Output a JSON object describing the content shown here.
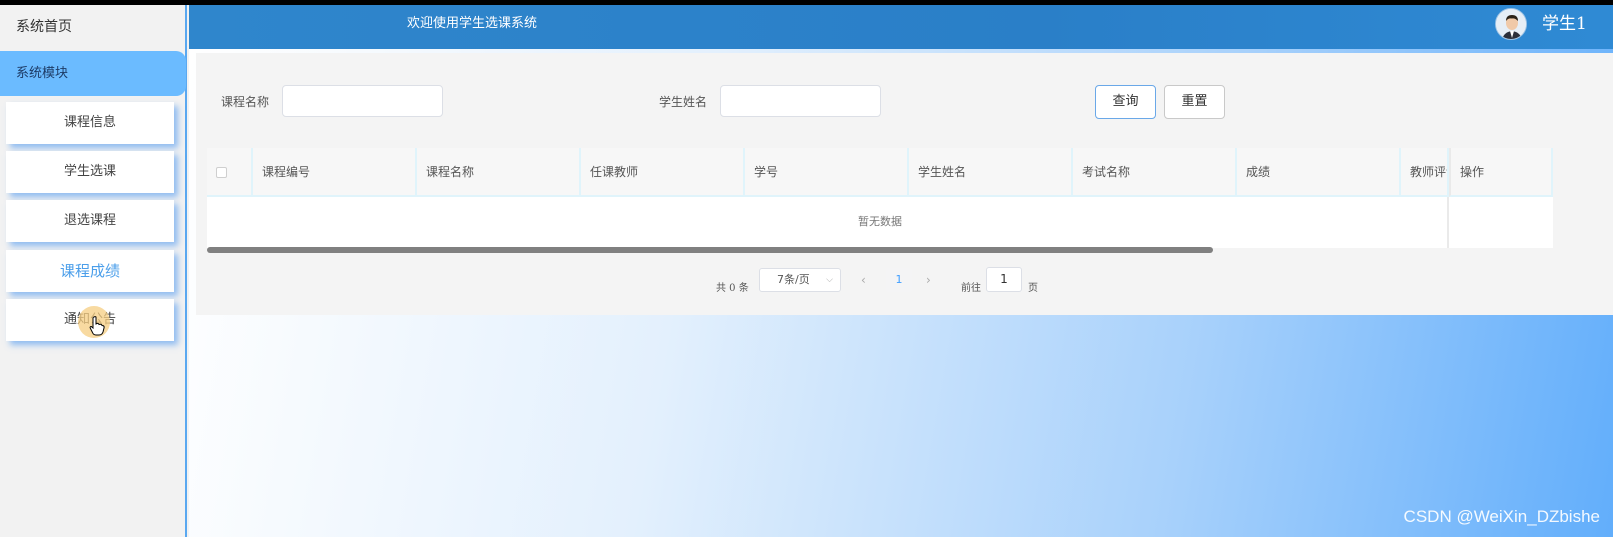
{
  "sidebar": {
    "home": "系统首页",
    "module": "系统模块",
    "items": [
      {
        "label": "课程信息"
      },
      {
        "label": "学生选课"
      },
      {
        "label": "退选课程"
      },
      {
        "label": "课程成绩"
      },
      {
        "label": "通知公告"
      }
    ],
    "active_index": 3
  },
  "header": {
    "title": "欢迎使用学生选课系统",
    "user": "学生1"
  },
  "search": {
    "course_label": "课程名称",
    "course_value": "",
    "student_label": "学生姓名",
    "student_value": "",
    "query_button": "查询",
    "reset_button": "重置"
  },
  "table": {
    "columns": [
      "课程编号",
      "课程名称",
      "任课教师",
      "学号",
      "学生姓名",
      "考试名称",
      "成绩",
      "教师评语",
      "操作"
    ],
    "rows": [],
    "empty_text": "暂无数据"
  },
  "pagination": {
    "total_text": "共 0 条",
    "page_size": "7条/页",
    "current_page": "1",
    "goto_label": "前往",
    "goto_value": "1",
    "page_suffix": "页"
  },
  "watermark": "CSDN @WeiXin_DZbishe",
  "colors": {
    "header": "#2a7fc8",
    "active_module": "#6bbbff",
    "active_item_text": "#4a9eea"
  }
}
